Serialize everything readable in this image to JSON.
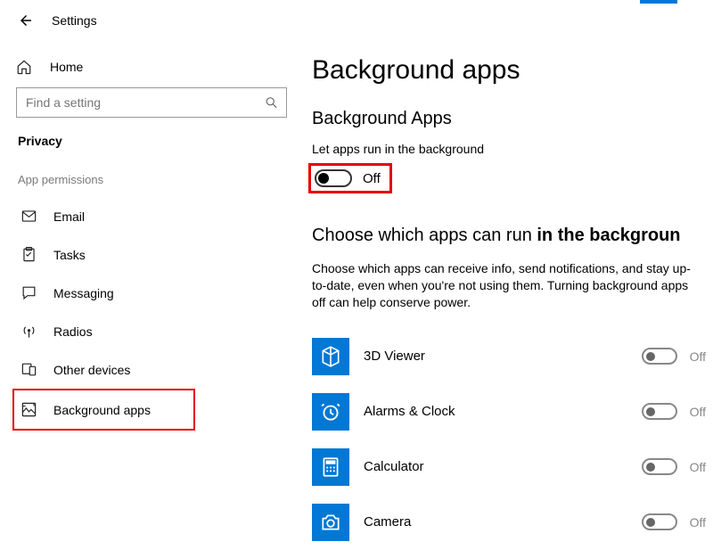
{
  "topbar": {
    "title": "Settings"
  },
  "sidebar": {
    "home": "Home",
    "search_placeholder": "Find a setting",
    "section": "Privacy",
    "group": "App permissions",
    "items": [
      {
        "label": "Email"
      },
      {
        "label": "Tasks"
      },
      {
        "label": "Messaging"
      },
      {
        "label": "Radios"
      },
      {
        "label": "Other devices"
      },
      {
        "label": "Background apps"
      }
    ]
  },
  "main": {
    "page_title": "Background apps",
    "sub_title": "Background Apps",
    "master_label": "Let apps run in the background",
    "master_state": "Off",
    "choose_title_a": "Choose which apps can run ",
    "choose_title_b": "in the backgroun",
    "choose_desc": "Choose which apps can receive info, send notifications, and stay up-to-date, even when you're not using them. Turning background apps off can help conserve power.",
    "apps": [
      {
        "name": "3D Viewer",
        "state": "Off"
      },
      {
        "name": "Alarms & Clock",
        "state": "Off"
      },
      {
        "name": "Calculator",
        "state": "Off"
      },
      {
        "name": "Camera",
        "state": "Off"
      }
    ]
  }
}
